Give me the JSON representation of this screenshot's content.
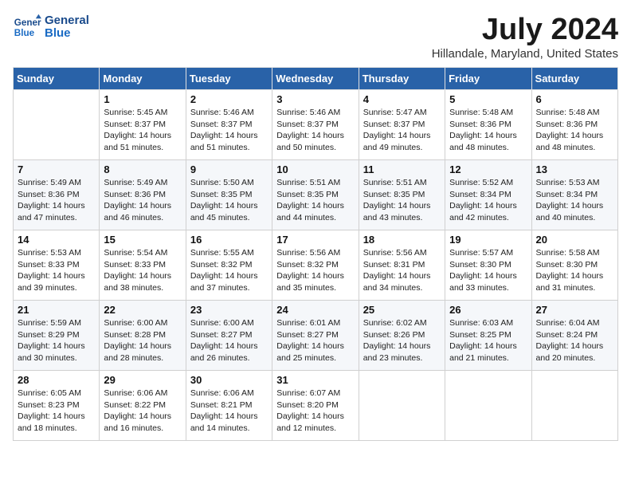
{
  "header": {
    "logo_line1": "General",
    "logo_line2": "Blue",
    "month_year": "July 2024",
    "location": "Hillandale, Maryland, United States"
  },
  "weekdays": [
    "Sunday",
    "Monday",
    "Tuesday",
    "Wednesday",
    "Thursday",
    "Friday",
    "Saturday"
  ],
  "weeks": [
    [
      {
        "day": "",
        "info": ""
      },
      {
        "day": "1",
        "info": "Sunrise: 5:45 AM\nSunset: 8:37 PM\nDaylight: 14 hours\nand 51 minutes."
      },
      {
        "day": "2",
        "info": "Sunrise: 5:46 AM\nSunset: 8:37 PM\nDaylight: 14 hours\nand 51 minutes."
      },
      {
        "day": "3",
        "info": "Sunrise: 5:46 AM\nSunset: 8:37 PM\nDaylight: 14 hours\nand 50 minutes."
      },
      {
        "day": "4",
        "info": "Sunrise: 5:47 AM\nSunset: 8:37 PM\nDaylight: 14 hours\nand 49 minutes."
      },
      {
        "day": "5",
        "info": "Sunrise: 5:48 AM\nSunset: 8:36 PM\nDaylight: 14 hours\nand 48 minutes."
      },
      {
        "day": "6",
        "info": "Sunrise: 5:48 AM\nSunset: 8:36 PM\nDaylight: 14 hours\nand 48 minutes."
      }
    ],
    [
      {
        "day": "7",
        "info": "Sunrise: 5:49 AM\nSunset: 8:36 PM\nDaylight: 14 hours\nand 47 minutes."
      },
      {
        "day": "8",
        "info": "Sunrise: 5:49 AM\nSunset: 8:36 PM\nDaylight: 14 hours\nand 46 minutes."
      },
      {
        "day": "9",
        "info": "Sunrise: 5:50 AM\nSunset: 8:35 PM\nDaylight: 14 hours\nand 45 minutes."
      },
      {
        "day": "10",
        "info": "Sunrise: 5:51 AM\nSunset: 8:35 PM\nDaylight: 14 hours\nand 44 minutes."
      },
      {
        "day": "11",
        "info": "Sunrise: 5:51 AM\nSunset: 8:35 PM\nDaylight: 14 hours\nand 43 minutes."
      },
      {
        "day": "12",
        "info": "Sunrise: 5:52 AM\nSunset: 8:34 PM\nDaylight: 14 hours\nand 42 minutes."
      },
      {
        "day": "13",
        "info": "Sunrise: 5:53 AM\nSunset: 8:34 PM\nDaylight: 14 hours\nand 40 minutes."
      }
    ],
    [
      {
        "day": "14",
        "info": "Sunrise: 5:53 AM\nSunset: 8:33 PM\nDaylight: 14 hours\nand 39 minutes."
      },
      {
        "day": "15",
        "info": "Sunrise: 5:54 AM\nSunset: 8:33 PM\nDaylight: 14 hours\nand 38 minutes."
      },
      {
        "day": "16",
        "info": "Sunrise: 5:55 AM\nSunset: 8:32 PM\nDaylight: 14 hours\nand 37 minutes."
      },
      {
        "day": "17",
        "info": "Sunrise: 5:56 AM\nSunset: 8:32 PM\nDaylight: 14 hours\nand 35 minutes."
      },
      {
        "day": "18",
        "info": "Sunrise: 5:56 AM\nSunset: 8:31 PM\nDaylight: 14 hours\nand 34 minutes."
      },
      {
        "day": "19",
        "info": "Sunrise: 5:57 AM\nSunset: 8:30 PM\nDaylight: 14 hours\nand 33 minutes."
      },
      {
        "day": "20",
        "info": "Sunrise: 5:58 AM\nSunset: 8:30 PM\nDaylight: 14 hours\nand 31 minutes."
      }
    ],
    [
      {
        "day": "21",
        "info": "Sunrise: 5:59 AM\nSunset: 8:29 PM\nDaylight: 14 hours\nand 30 minutes."
      },
      {
        "day": "22",
        "info": "Sunrise: 6:00 AM\nSunset: 8:28 PM\nDaylight: 14 hours\nand 28 minutes."
      },
      {
        "day": "23",
        "info": "Sunrise: 6:00 AM\nSunset: 8:27 PM\nDaylight: 14 hours\nand 26 minutes."
      },
      {
        "day": "24",
        "info": "Sunrise: 6:01 AM\nSunset: 8:27 PM\nDaylight: 14 hours\nand 25 minutes."
      },
      {
        "day": "25",
        "info": "Sunrise: 6:02 AM\nSunset: 8:26 PM\nDaylight: 14 hours\nand 23 minutes."
      },
      {
        "day": "26",
        "info": "Sunrise: 6:03 AM\nSunset: 8:25 PM\nDaylight: 14 hours\nand 21 minutes."
      },
      {
        "day": "27",
        "info": "Sunrise: 6:04 AM\nSunset: 8:24 PM\nDaylight: 14 hours\nand 20 minutes."
      }
    ],
    [
      {
        "day": "28",
        "info": "Sunrise: 6:05 AM\nSunset: 8:23 PM\nDaylight: 14 hours\nand 18 minutes."
      },
      {
        "day": "29",
        "info": "Sunrise: 6:06 AM\nSunset: 8:22 PM\nDaylight: 14 hours\nand 16 minutes."
      },
      {
        "day": "30",
        "info": "Sunrise: 6:06 AM\nSunset: 8:21 PM\nDaylight: 14 hours\nand 14 minutes."
      },
      {
        "day": "31",
        "info": "Sunrise: 6:07 AM\nSunset: 8:20 PM\nDaylight: 14 hours\nand 12 minutes."
      },
      {
        "day": "",
        "info": ""
      },
      {
        "day": "",
        "info": ""
      },
      {
        "day": "",
        "info": ""
      }
    ]
  ]
}
